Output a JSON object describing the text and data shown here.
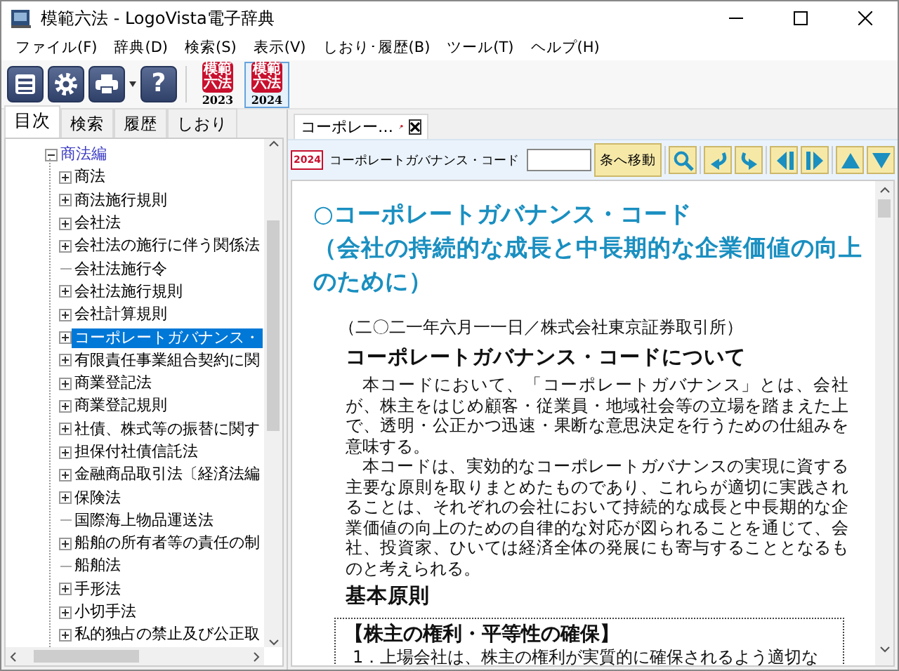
{
  "window": {
    "title": "模範六法 - LogoVista電子辞典"
  },
  "menu": [
    {
      "label": "ファイル(F)"
    },
    {
      "label": "辞典(D)"
    },
    {
      "label": "検索(S)"
    },
    {
      "label": "表示(V)"
    },
    {
      "label": "しおり･履歴(B)"
    },
    {
      "label": "ツール(T)"
    },
    {
      "label": "ヘルプ(H)"
    }
  ],
  "toolbar": {
    "help_glyph": "?",
    "editions": [
      {
        "name": "模範六法",
        "year": "2023",
        "selected": false
      },
      {
        "name": "模範六法",
        "year": "2024",
        "selected": true
      }
    ]
  },
  "sidebar": {
    "tabs": [
      {
        "label": "目次",
        "selected": true
      },
      {
        "label": "検索",
        "selected": false
      },
      {
        "label": "履歴",
        "selected": false
      },
      {
        "label": "しおり",
        "selected": false
      }
    ],
    "tree": {
      "label": "商法編",
      "expanded": true,
      "selected": false,
      "children": [
        {
          "label": "商法",
          "expanded": false,
          "selected": false
        },
        {
          "label": "商法施行規則",
          "expanded": false,
          "selected": false
        },
        {
          "label": "会社法",
          "expanded": false,
          "selected": false
        },
        {
          "label": "会社法の施行に伴う関係法",
          "expanded": false,
          "selected": false
        },
        {
          "label": "会社法施行令",
          "selected": false
        },
        {
          "label": "会社法施行規則",
          "expanded": false,
          "selected": false
        },
        {
          "label": "会社計算規則",
          "expanded": false,
          "selected": false
        },
        {
          "label": "コーポレートガバナンス・",
          "expanded": false,
          "selected": true
        },
        {
          "label": "有限責任事業組合契約に関",
          "expanded": false,
          "selected": false
        },
        {
          "label": "商業登記法",
          "expanded": false,
          "selected": false
        },
        {
          "label": "商業登記規則",
          "expanded": false,
          "selected": false
        },
        {
          "label": "社債、株式等の振替に関す",
          "expanded": false,
          "selected": false
        },
        {
          "label": "担保付社債信託法",
          "expanded": false,
          "selected": false
        },
        {
          "label": "金融商品取引法〔経済法編",
          "expanded": false,
          "selected": false
        },
        {
          "label": "保険法",
          "expanded": false,
          "selected": false
        },
        {
          "label": "国際海上物品運送法",
          "selected": false
        },
        {
          "label": "船舶の所有者等の責任の制",
          "expanded": false,
          "selected": false
        },
        {
          "label": "船舶法",
          "selected": false
        },
        {
          "label": "手形法",
          "expanded": false,
          "selected": false
        },
        {
          "label": "小切手法",
          "expanded": false,
          "selected": false
        },
        {
          "label": "私的独占の禁止及び公正取",
          "expanded": false,
          "selected": false
        }
      ]
    }
  },
  "document": {
    "tab": {
      "label": "コーポレー…"
    },
    "toolbar": {
      "badge": "2024",
      "title": "コーポレートガバナンス・コード",
      "jump_button": "条へ移動"
    },
    "title_lines": [
      "○コーポレートガバナンス・コード",
      "（会社の持続的な成長と中長期的な企業価値の向上のために）"
    ],
    "date_line": "（二〇二一年六月一一日／株式会社東京証券取引所）",
    "sections": [
      {
        "heading": "コーポレートガバナンス・コードについて",
        "paragraphs": [
          "本コードにおいて、「コーポレートガバナンス」とは、会社が、株主をはじめ顧客・従業員・地域社会等の立場を踏まえた上で、透明・公正かつ迅速・果断な意思決定を行うための仕組みを意味する。",
          "本コードは、実効的なコーポレートガバナンスの実現に資する主要な原則を取りまとめたものであり、これらが適切に実践されることは、それぞれの会社において持続的な成長と中長期的な企業価値の向上のための自律的な対応が図られることを通じて、会社、投資家、ひいては経済全体の発展にも寄与することとなるものと考えられる。"
        ]
      },
      {
        "heading": "基本原則",
        "box": {
          "heading": "【株主の権利・平等性の確保】",
          "item": "1．上場会社は、株主の権利が実質的に確保されるよう適切な"
        }
      }
    ]
  }
}
